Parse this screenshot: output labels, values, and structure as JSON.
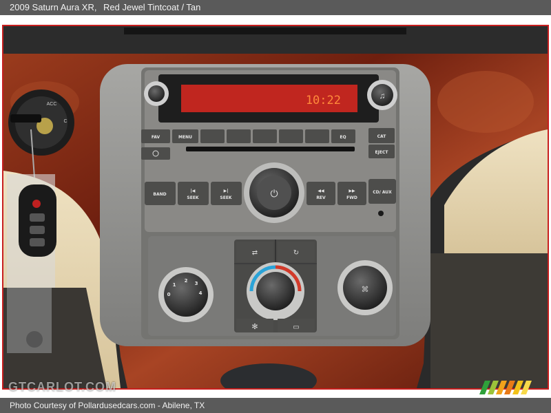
{
  "header": {
    "vehicle": "2009 Saturn Aura XR,",
    "color": "Red Jewel Tintcoat / Tan"
  },
  "footer": {
    "credit": "Photo Courtesy of Pollardusedcars.com - Abilene, TX"
  },
  "watermark": {
    "text": "GTCARLOT.COM"
  },
  "radio": {
    "clock": "10:22",
    "buttons": {
      "fav": "FAV",
      "menu": "MENU",
      "eq": "EQ",
      "cat": "CAT",
      "eject": "EJECT",
      "band": "BAND",
      "seek_back": "SEEK",
      "seek_fwd": "SEEK",
      "rev": "REV",
      "fwd": "FWD",
      "cd_aux": "CD/ AUX"
    },
    "display_color": "#c0261f"
  },
  "climate": {
    "fan_numbers": [
      "0",
      "1",
      "2",
      "3",
      "4"
    ]
  },
  "ignition": {
    "labels": [
      "ACC",
      "C"
    ]
  },
  "colors": {
    "wood": "#7a2614",
    "tan_trim": "#e6d7b3",
    "bezel": "#8f8f8d",
    "frame": "#c81e1e",
    "bar": "#5a5a5a"
  }
}
